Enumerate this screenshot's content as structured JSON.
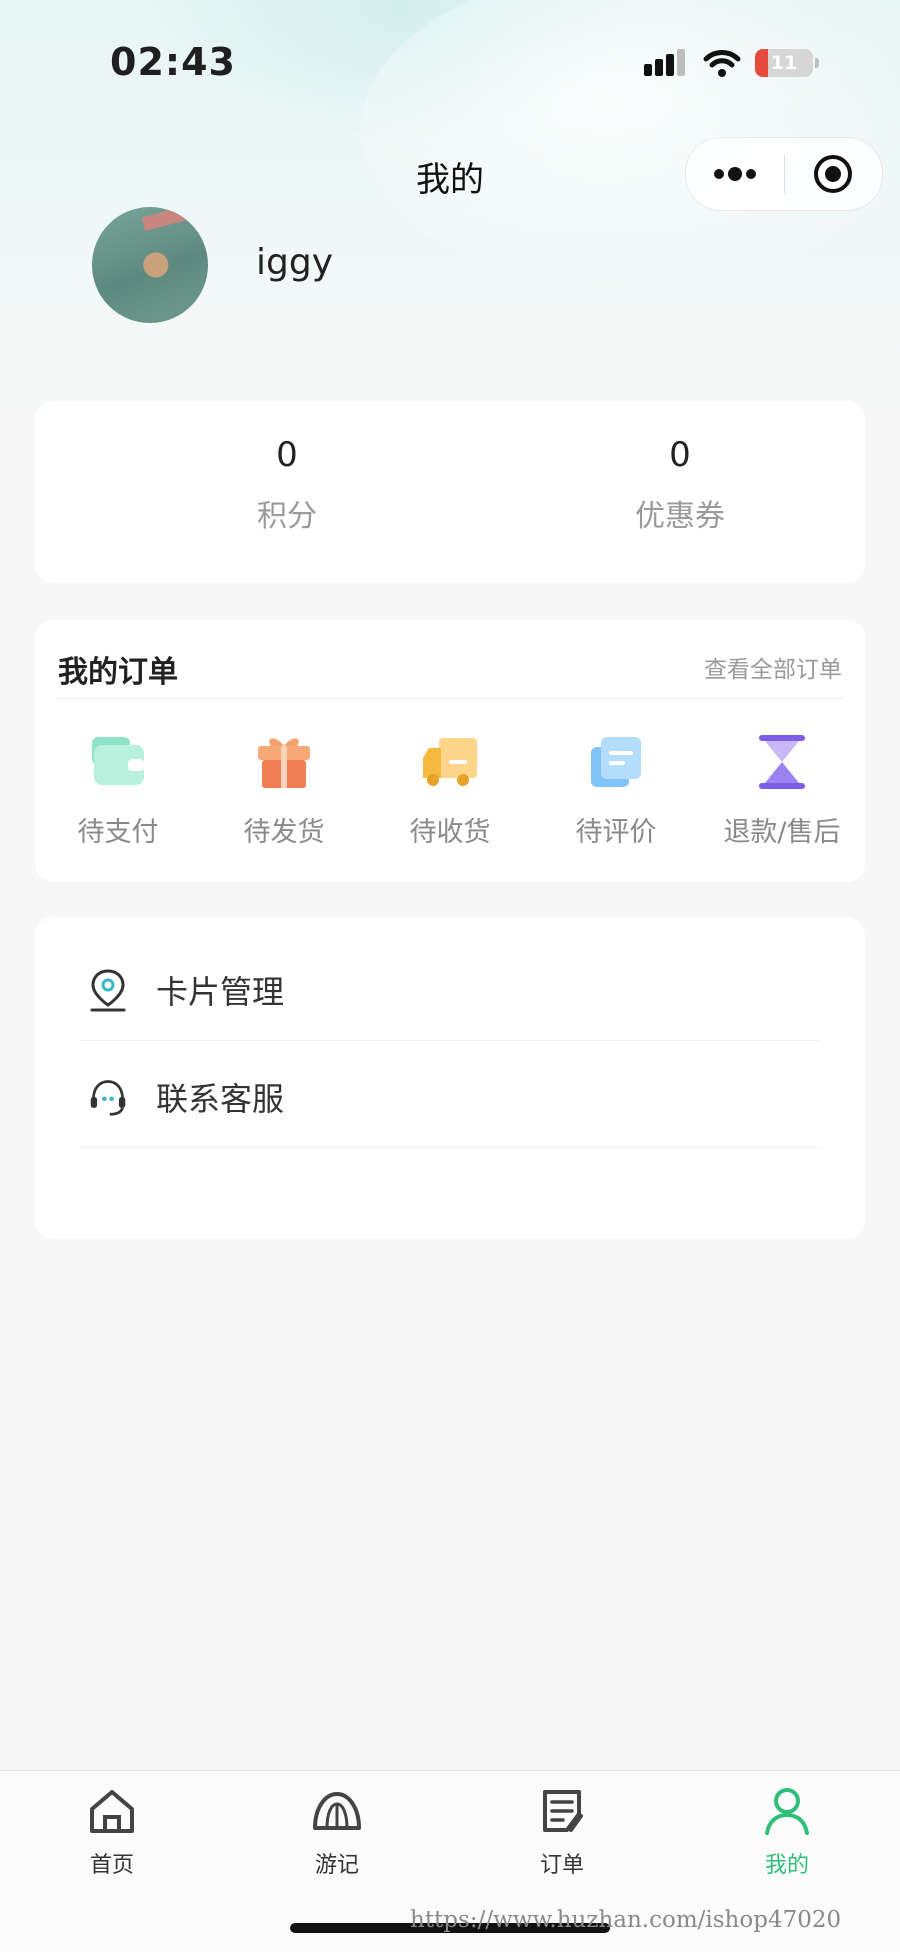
{
  "status_bar": {
    "time": "02:43",
    "battery": "11",
    "battery_level": 0.11
  },
  "nav": {
    "title": "我的"
  },
  "profile": {
    "username": "iggy"
  },
  "stats": [
    {
      "value": "0",
      "label": "积分"
    },
    {
      "value": "0",
      "label": "优惠券"
    }
  ],
  "orders": {
    "title": "我的订单",
    "view_all": "查看全部订单",
    "items": [
      {
        "label": "待支付",
        "icon": "wallet-icon"
      },
      {
        "label": "待发货",
        "icon": "gift-icon"
      },
      {
        "label": "待收货",
        "icon": "truck-icon"
      },
      {
        "label": "待评价",
        "icon": "document-icon"
      },
      {
        "label": "退款/售后",
        "icon": "hourglass-icon"
      }
    ]
  },
  "menu": [
    {
      "label": "卡片管理",
      "icon": "location-pin-icon"
    },
    {
      "label": "联系客服",
      "icon": "headset-icon"
    }
  ],
  "tabbar": {
    "active": 3,
    "active_color": "#2fbf7a",
    "items": [
      {
        "label": "首页",
        "icon": "home-icon"
      },
      {
        "label": "游记",
        "icon": "dome-icon"
      },
      {
        "label": "订单",
        "icon": "order-list-icon"
      },
      {
        "label": "我的",
        "icon": "person-icon"
      }
    ]
  },
  "watermark": "https://www.huzhan.com/ishop47020"
}
